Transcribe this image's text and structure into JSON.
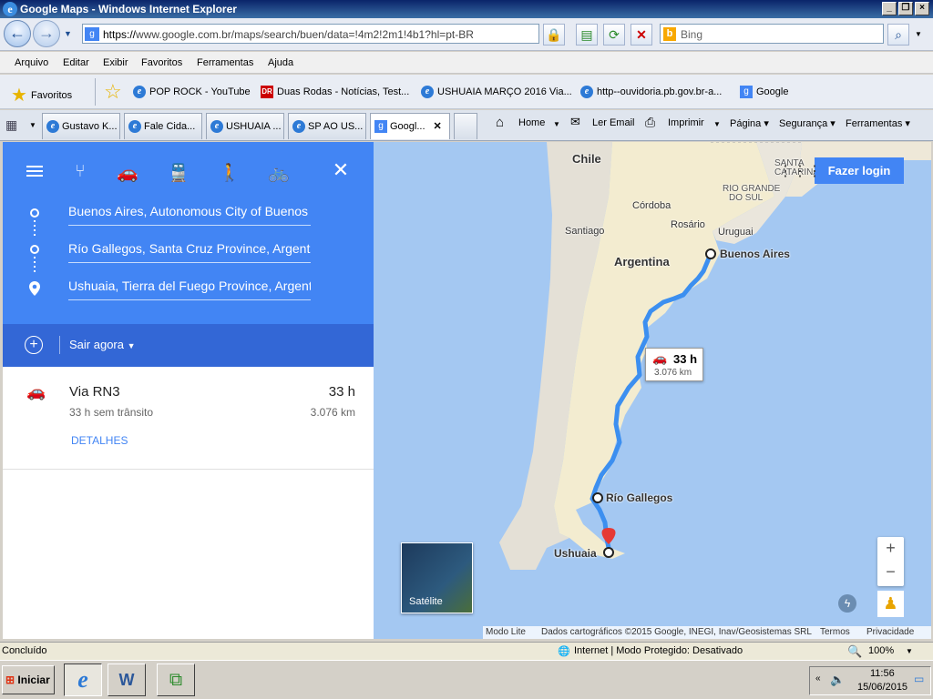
{
  "window": {
    "title": "Google Maps - Windows Internet Explorer"
  },
  "address": {
    "url_prefix": "https://",
    "url_domain": "www.google.com.br",
    "url_path": "/maps/search/buen/data=!4m2!2m1!4b1?hl=pt-BR",
    "search_placeholder": "Bing"
  },
  "menu": [
    "Arquivo",
    "Editar",
    "Exibir",
    "Favoritos",
    "Ferramentas",
    "Ajuda"
  ],
  "favorites": {
    "label": "Favoritos",
    "items": [
      "POP ROCK - YouTube",
      "Duas Rodas - Notícias, Test...",
      "USHUAIA MARÇO 2016  Via...",
      "http--ouvidoria.pb.gov.br-a...",
      "Google"
    ]
  },
  "tabs": [
    "Gustavo K...",
    "Fale Cida...",
    "USHUAIA ...",
    "SP AO US...",
    "Googl..."
  ],
  "commands": {
    "home": "Home",
    "email": "Ler Email",
    "print": "Imprimir",
    "page": "Página",
    "security": "Segurança",
    "tools": "Ferramentas"
  },
  "directions": {
    "waypoints": [
      "Buenos Aires, Autonomous City of Buenos Aires",
      "Río Gallegos, Santa Cruz Province, Argentina",
      "Ushuaia, Tierra del Fuego Province, Argentina"
    ],
    "depart": "Sair agora",
    "route": {
      "name": "Via RN3",
      "duration": "33 h",
      "traffic": "33 h sem trânsito",
      "distance": "3.076 km",
      "details": "DETALHES"
    }
  },
  "map": {
    "login": "Fazer login",
    "labels": {
      "chile": "Chile",
      "argentina": "Argentina",
      "uruguai": "Uruguai",
      "rio_grande": "RIO GRANDE",
      "do_sul": "DO SUL",
      "santa": "SANTA",
      "catarina": "CATARINA",
      "cordoba": "Córdoba",
      "rosario": "Rosário",
      "santiago": "Santiago",
      "buenos_aires": "Buenos Aires",
      "rio_gallegos": "Río Gallegos",
      "ushuaia": "Ushuaia"
    },
    "callout": {
      "duration": "33 h",
      "distance": "3.076 km"
    },
    "satellite": "Satélite",
    "zoom_in": "+",
    "zoom_out": "−",
    "footer": [
      "Modo Lite",
      "Dados cartográficos ©2015 Google, INEGI, Inav/Geosistemas SRL",
      "Termos",
      "Privacidade"
    ]
  },
  "status": {
    "left": "Concluído",
    "zone": "Internet | Modo Protegido: Desativado",
    "zoom": "100%"
  },
  "taskbar": {
    "start": "Iniciar",
    "time": "11:56",
    "date": "15/06/2015"
  }
}
